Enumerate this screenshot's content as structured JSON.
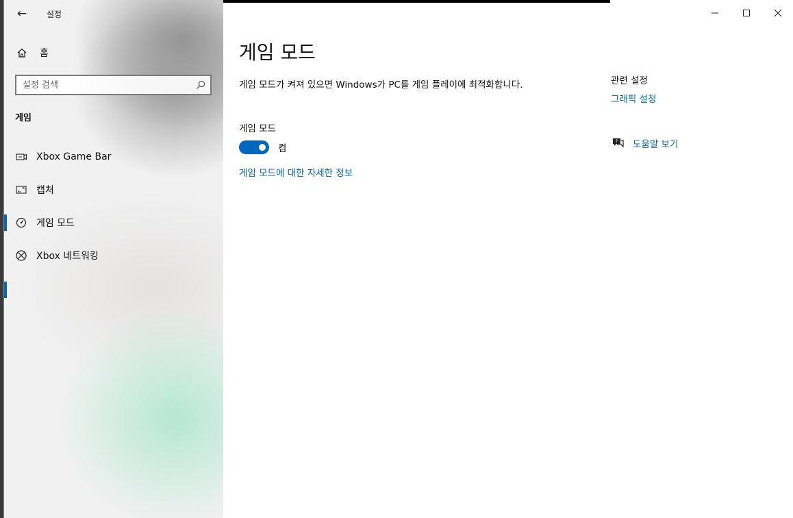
{
  "window": {
    "app_title": "설정",
    "back_label": "←"
  },
  "sidebar": {
    "home_label": "홈",
    "search_placeholder": "설정 검색",
    "section_label": "게임",
    "items": [
      {
        "label": "Xbox Game Bar",
        "icon": "gamebar-icon"
      },
      {
        "label": "캡처",
        "icon": "capture-icon"
      },
      {
        "label": "게임 모드",
        "icon": "gamemode-icon",
        "active": true
      },
      {
        "label": "Xbox 네트워킹",
        "icon": "xbox-icon"
      }
    ]
  },
  "main": {
    "page_title": "게임 모드",
    "description": "게임 모드가 켜져 있으면 Windows가 PC를 게임 플레이에 최적화합니다.",
    "setting_label": "게임 모드",
    "toggle_state_label": "켬",
    "toggle_on": true,
    "more_info_link": "게임 모드에 대한 자세한 정보"
  },
  "related": {
    "title": "관련 설정",
    "link": "그래픽 설정",
    "help_link": "도움말 보기"
  },
  "colors": {
    "accent": "#0067c0"
  }
}
